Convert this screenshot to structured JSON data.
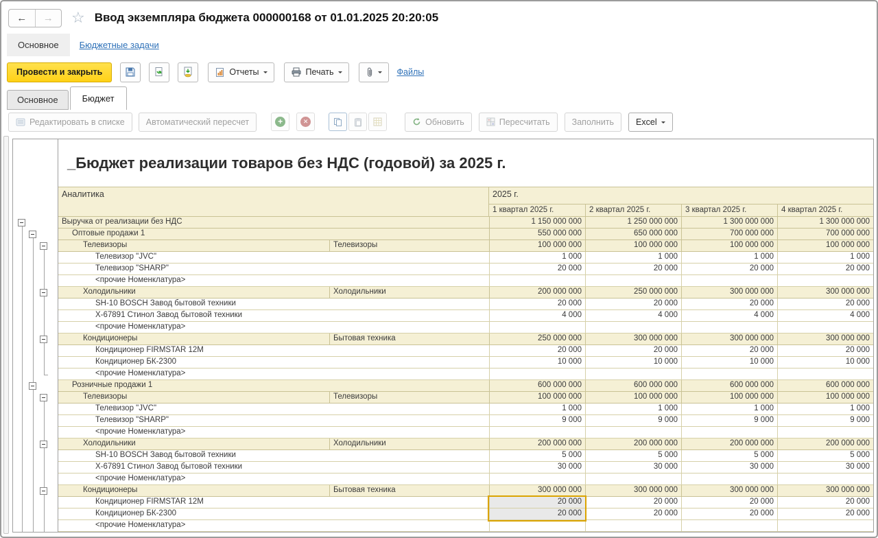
{
  "icons": {
    "back": "←",
    "forward": "→",
    "star": "☆"
  },
  "window": {
    "title": "Ввод экземпляра бюджета 000000168 от 01.01.2025 20:20:05"
  },
  "nav_tabs": {
    "main": "Основное",
    "tasks": "Бюджетные задачи"
  },
  "command_bar": {
    "post_close": "Провести и закрыть",
    "reports": "Отчеты",
    "print": "Печать",
    "files": "Файлы"
  },
  "form_tabs": {
    "main": "Основное",
    "budget": "Бюджет"
  },
  "table_toolbar": {
    "edit_in_list": "Редактировать в списке",
    "auto_recalc": "Автоматический пересчет",
    "refresh": "Обновить",
    "recalc": "Пересчитать",
    "fill": "Заполнить",
    "excel": "Excel"
  },
  "budget": {
    "title": "_Бюджет реализации товаров без НДС (годовой) за 2025 г.",
    "analytics_header": "Аналитика",
    "year_header": "2025 г.",
    "quarter_headers": [
      "1 квартал 2025 г.",
      "2 квартал 2025 г.",
      "3 квартал 2025 г.",
      "4 квартал 2025 г."
    ],
    "selection": {
      "quarter_index": 0,
      "row_indexes": [
        24,
        25
      ]
    },
    "rows": [
      {
        "label": "Выручка от реализации без НДС",
        "label2": "",
        "level": 1,
        "group": true,
        "values": [
          "1 150 000 000",
          "1 250 000 000",
          "1 300 000 000",
          "1 300 000 000"
        ]
      },
      {
        "label": "Оптовые продажи 1",
        "label2": "",
        "level": 2,
        "group": true,
        "values": [
          "550 000 000",
          "650 000 000",
          "700 000 000",
          "700 000 000"
        ]
      },
      {
        "label": "Телевизоры",
        "label2": "Телевизоры",
        "level": 3,
        "group": true,
        "values": [
          "100 000 000",
          "100 000 000",
          "100 000 000",
          "100 000 000"
        ]
      },
      {
        "label": "Телевизор \"JVC\"",
        "label2": "",
        "level": 4,
        "group": false,
        "values": [
          "1 000",
          "1 000",
          "1 000",
          "1 000"
        ]
      },
      {
        "label": "Телевизор \"SHARP\"",
        "label2": "",
        "level": 4,
        "group": false,
        "values": [
          "20 000",
          "20 000",
          "20 000",
          "20 000"
        ]
      },
      {
        "label": "<прочие Номенклатура>",
        "label2": "",
        "level": 4,
        "group": false,
        "values": [
          "",
          "",
          "",
          ""
        ]
      },
      {
        "label": "Холодильники",
        "label2": "Холодильники",
        "level": 3,
        "group": true,
        "values": [
          "200 000 000",
          "250 000 000",
          "300 000 000",
          "300 000 000"
        ]
      },
      {
        "label": "SH-10 BOSCH Завод бытовой техники",
        "label2": "",
        "level": 4,
        "group": false,
        "values": [
          "20 000",
          "20 000",
          "20 000",
          "20 000"
        ]
      },
      {
        "label": "Х-67891 Стинол Завод бытовой техники",
        "label2": "",
        "level": 4,
        "group": false,
        "values": [
          "4 000",
          "4 000",
          "4 000",
          "4 000"
        ]
      },
      {
        "label": "<прочие Номенклатура>",
        "label2": "",
        "level": 4,
        "group": false,
        "values": [
          "",
          "",
          "",
          ""
        ]
      },
      {
        "label": "Кондиционеры",
        "label2": "Бытовая техника",
        "level": 3,
        "group": true,
        "values": [
          "250 000 000",
          "300 000 000",
          "300 000 000",
          "300 000 000"
        ]
      },
      {
        "label": "Кондиционер FIRMSTAR 12M",
        "label2": "",
        "level": 4,
        "group": false,
        "values": [
          "20 000",
          "20 000",
          "20 000",
          "20 000"
        ]
      },
      {
        "label": "Кондиционер БК-2300",
        "label2": "",
        "level": 4,
        "group": false,
        "values": [
          "10 000",
          "10 000",
          "10 000",
          "10 000"
        ]
      },
      {
        "label": "<прочие Номенклатура>",
        "label2": "",
        "level": 4,
        "group": false,
        "values": [
          "",
          "",
          "",
          ""
        ]
      },
      {
        "label": "Розничные  продажи 1",
        "label2": "",
        "level": 2,
        "group": true,
        "values": [
          "600 000 000",
          "600 000 000",
          "600 000 000",
          "600 000 000"
        ]
      },
      {
        "label": "Телевизоры",
        "label2": "Телевизоры",
        "level": 3,
        "group": true,
        "values": [
          "100 000 000",
          "100 000 000",
          "100 000 000",
          "100 000 000"
        ]
      },
      {
        "label": "Телевизор \"JVC\"",
        "label2": "",
        "level": 4,
        "group": false,
        "values": [
          "1 000",
          "1 000",
          "1 000",
          "1 000"
        ]
      },
      {
        "label": "Телевизор \"SHARP\"",
        "label2": "",
        "level": 4,
        "group": false,
        "values": [
          "9 000",
          "9 000",
          "9 000",
          "9 000"
        ]
      },
      {
        "label": "<прочие Номенклатура>",
        "label2": "",
        "level": 4,
        "group": false,
        "values": [
          "",
          "",
          "",
          ""
        ]
      },
      {
        "label": "Холодильники",
        "label2": "Холодильники",
        "level": 3,
        "group": true,
        "values": [
          "200 000 000",
          "200 000 000",
          "200 000 000",
          "200 000 000"
        ]
      },
      {
        "label": "SH-10 BOSCH Завод бытовой техники",
        "label2": "",
        "level": 4,
        "group": false,
        "values": [
          "5 000",
          "5 000",
          "5 000",
          "5 000"
        ]
      },
      {
        "label": "Х-67891 Стинол Завод бытовой техники",
        "label2": "",
        "level": 4,
        "group": false,
        "values": [
          "30 000",
          "30 000",
          "30 000",
          "30 000"
        ]
      },
      {
        "label": "<прочие Номенклатура>",
        "label2": "",
        "level": 4,
        "group": false,
        "values": [
          "",
          "",
          "",
          ""
        ]
      },
      {
        "label": "Кондиционеры",
        "label2": "Бытовая техника",
        "level": 3,
        "group": true,
        "values": [
          "300 000 000",
          "300 000 000",
          "300 000 000",
          "300 000 000"
        ]
      },
      {
        "label": "Кондиционер FIRMSTAR 12M",
        "label2": "",
        "level": 4,
        "group": false,
        "values": [
          "20 000",
          "20 000",
          "20 000",
          "20 000"
        ]
      },
      {
        "label": "Кондиционер БК-2300",
        "label2": "",
        "level": 4,
        "group": false,
        "values": [
          "20 000",
          "20 000",
          "20 000",
          "20 000"
        ]
      },
      {
        "label": "<прочие Номенклатура>",
        "label2": "",
        "level": 4,
        "group": false,
        "values": [
          "",
          "",
          "",
          ""
        ]
      }
    ]
  },
  "colors": {
    "accent_yellow": "#FFD117",
    "link_blue": "#2E71B8",
    "band_beige": "#F5F0D5",
    "grid_line": "#C9C295",
    "selection_gold": "#DBA400",
    "selected_cell_bg": "#E9E9E9"
  }
}
